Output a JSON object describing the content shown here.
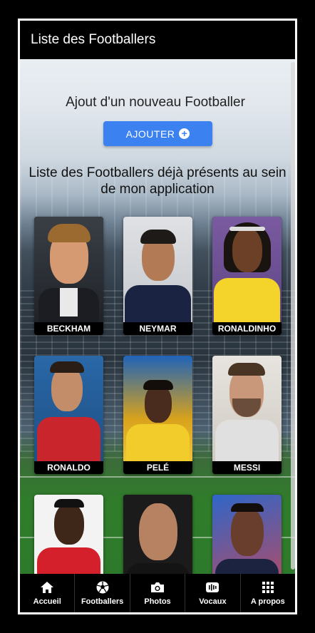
{
  "header": {
    "title": "Liste des Footballers"
  },
  "ajout": {
    "title": "Ajout d'un nouveau Footballer",
    "button_label": "AJOUTER"
  },
  "liste": {
    "title": "Liste des Footballers déjà présents au sein de mon application"
  },
  "players": [
    {
      "name": "BECKHAM"
    },
    {
      "name": "NEYMAR"
    },
    {
      "name": "RONALDINHO"
    },
    {
      "name": "RONALDO"
    },
    {
      "name": "PELÉ"
    },
    {
      "name": "MESSI"
    },
    {
      "name": ""
    },
    {
      "name": ""
    },
    {
      "name": ""
    }
  ],
  "nav": [
    {
      "label": "Accueil",
      "icon": "home-icon"
    },
    {
      "label": "Footballers",
      "icon": "football-icon"
    },
    {
      "label": "Photos",
      "icon": "camera-icon"
    },
    {
      "label": "Vocaux",
      "icon": "voice-icon"
    },
    {
      "label": "A propos",
      "icon": "grid-icon"
    }
  ],
  "colors": {
    "button": "#3b82f0",
    "header": "#000000"
  }
}
